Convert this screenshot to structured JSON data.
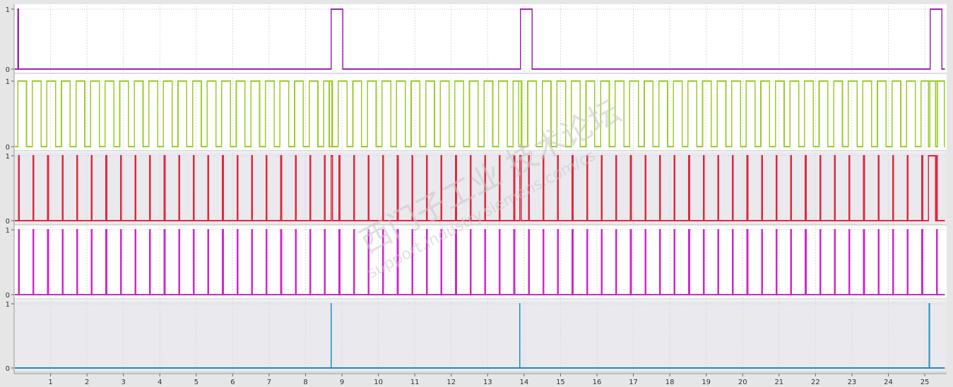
{
  "chart_data": {
    "type": "line",
    "step": true,
    "xlim": [
      0,
      25.6
    ],
    "xticks": [
      1,
      2,
      3,
      4,
      5,
      6,
      7,
      8,
      9,
      10,
      11,
      12,
      13,
      14,
      15,
      16,
      17,
      18,
      19,
      20,
      21,
      22,
      23,
      24,
      25
    ],
    "xtick_labels": [
      "1",
      "2",
      "3",
      "4",
      "5",
      "6",
      "7",
      "8",
      "9",
      "10",
      "11",
      "12",
      "13",
      "14",
      "15",
      "16",
      "17",
      "18",
      "19",
      "20",
      "21",
      "22",
      "23",
      "24",
      "25"
    ],
    "grid": true,
    "watermark": {
      "line1": "西门子工业 技术论坛",
      "line2": "support.industry.siemens.com/cs"
    },
    "panels": [
      {
        "name": "",
        "ylim": [
          0,
          1
        ],
        "y_tick_labels": [
          "1",
          "0"
        ],
        "color": "#9b27b0",
        "background": "#ffffff",
        "pattern": "pulses",
        "pulses": [
          [
            0.1,
            0.12
          ],
          [
            8.7,
            9.02
          ],
          [
            13.9,
            14.22
          ],
          [
            25.15,
            25.47
          ]
        ]
      },
      {
        "name": "",
        "ylim": [
          0,
          1
        ],
        "y_tick_labels": [
          "1",
          "0"
        ],
        "color": "#9ccb2b",
        "background": "#ffffff",
        "pattern": "periodic",
        "period": 0.4,
        "duty": 0.6,
        "start": 0.1,
        "end": 25.55,
        "extra_pulses": [
          [
            8.65,
            8.72
          ],
          [
            13.85,
            13.92
          ],
          [
            25.1,
            25.35
          ]
        ]
      },
      {
        "name": "",
        "ylim": [
          0,
          1
        ],
        "y_tick_labels": [
          "1",
          "0"
        ],
        "color": "#e0283d",
        "background": "#e9e9ee",
        "pattern": "periodic",
        "period": 0.4,
        "duty": 0.05,
        "start": 0.12,
        "end": 25.55,
        "extra_pulses": [
          [
            8.7,
            8.74
          ],
          [
            13.88,
            13.92
          ],
          [
            25.1,
            25.3
          ]
        ]
      },
      {
        "name": "",
        "ylim": [
          0,
          1
        ],
        "y_tick_labels": [
          "1",
          "0"
        ],
        "color": "#d027c8",
        "background": "#ffffff",
        "pattern": "periodic",
        "period": 0.4,
        "duty": 0.05,
        "start": 0.12,
        "end": 25.55,
        "extra_pulses": []
      },
      {
        "name": "",
        "ylim": [
          0,
          1
        ],
        "y_tick_labels": [
          "1",
          "0"
        ],
        "color": "#1a8fbf",
        "background": "#e9e9ee",
        "pattern": "pulses",
        "pulses": [
          [
            8.7,
            8.705
          ],
          [
            13.88,
            13.885
          ],
          [
            25.12,
            25.125
          ]
        ]
      }
    ]
  }
}
